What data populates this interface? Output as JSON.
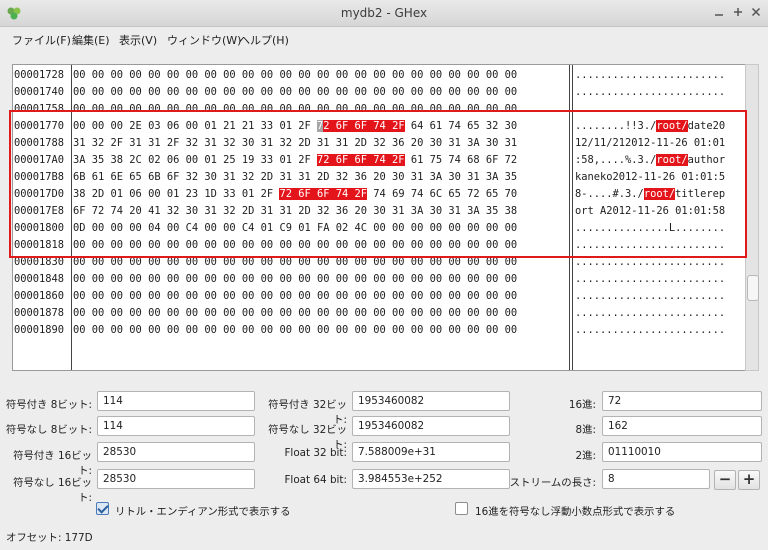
{
  "window": {
    "title": "mydb2 - GHex"
  },
  "menu": [
    "ファイル(F)",
    "編集(E)",
    "表示(V)",
    "ウィンドウ(W)",
    "ヘルプ(H)"
  ],
  "hex": {
    "offsets": [
      "00001728",
      "00001740",
      "00001758",
      "00001770",
      "00001788",
      "000017A0",
      "000017B8",
      "000017D0",
      "000017E8",
      "00001800",
      "00001818",
      "00001830",
      "00001848",
      "00001860",
      "00001878",
      "00001890"
    ],
    "hex_rows": [
      [
        {
          "t": "00 00 00 00 00 00 00 00 00 00 00 00 00 00 00 00 00 00 00 00 00 00 00 00"
        }
      ],
      [
        {
          "t": "00 00 00 00 00 00 00 00 00 00 00 00 00 00 00 00 00 00 00 00 00 00 00 00"
        }
      ],
      [
        {
          "t": "00 00 00 00 00 00 00 00 00 00 00 00 00 00 00 00 00 00 00 00 00 00 00 00"
        }
      ],
      [
        {
          "t": "00 00 00 2E 03 06 00 01 21 21 33 01 2F "
        },
        {
          "t": "7",
          "c": "cur"
        },
        {
          "t": "2 6F 6F 74 2F",
          "c": "hl"
        },
        {
          "t": " 64 61 74 65 32 30"
        }
      ],
      [
        {
          "t": "31 32 2F 31 31 2F 32 31 32 30 31 32 2D 31 31 2D 32 36 20 30 31 3A 30 31"
        }
      ],
      [
        {
          "t": "3A 35 38 2C 02 06 00 01 25 19 33 01 2F "
        },
        {
          "t": "72 6F 6F 74 2F",
          "c": "hl"
        },
        {
          "t": " 61 75 74 68 6F 72"
        }
      ],
      [
        {
          "t": "6B 61 6E 65 6B 6F 32 30 31 32 2D 31 31 2D 32 36 20 30 31 3A 30 31 3A 35"
        }
      ],
      [
        {
          "t": "38 2D 01 06 00 01 23 1D 33 01 2F "
        },
        {
          "t": "72 6F 6F 74 2F",
          "c": "hl"
        },
        {
          "t": " 74 69 74 6C 65 72 65 70"
        }
      ],
      [
        {
          "t": "6F 72 74 20 41 32 30 31 32 2D 31 31 2D 32 36 20 30 31 3A 30 31 3A 35 38"
        }
      ],
      [
        {
          "t": "0D 00 00 00 04 00 C4 00 00 C4 01 C9 01 FA 02 4C 00 00 00 00 00 00 00 00"
        }
      ],
      [
        {
          "t": "00 00 00 00 00 00 00 00 00 00 00 00 00 00 00 00 00 00 00 00 00 00 00 00"
        }
      ],
      [
        {
          "t": "00 00 00 00 00 00 00 00 00 00 00 00 00 00 00 00 00 00 00 00 00 00 00 00"
        }
      ],
      [
        {
          "t": "00 00 00 00 00 00 00 00 00 00 00 00 00 00 00 00 00 00 00 00 00 00 00 00"
        }
      ],
      [
        {
          "t": "00 00 00 00 00 00 00 00 00 00 00 00 00 00 00 00 00 00 00 00 00 00 00 00"
        }
      ],
      [
        {
          "t": "00 00 00 00 00 00 00 00 00 00 00 00 00 00 00 00 00 00 00 00 00 00 00 00"
        }
      ],
      [
        {
          "t": "00 00 00 00 00 00 00 00 00 00 00 00 00 00 00 00 00 00 00 00 00 00 00 00"
        }
      ]
    ],
    "ascii_rows": [
      [
        {
          "t": "........................"
        }
      ],
      [
        {
          "t": "........................"
        }
      ],
      [
        {
          "t": "........................"
        }
      ],
      [
        {
          "t": "........!!3./"
        },
        {
          "t": "root/",
          "c": "hl"
        },
        {
          "t": "date20"
        }
      ],
      [
        {
          "t": "12/11/212012-11-26 01:01"
        }
      ],
      [
        {
          "t": ":58,....%.3./"
        },
        {
          "t": "root/",
          "c": "hl"
        },
        {
          "t": "author"
        }
      ],
      [
        {
          "t": "kaneko2012-11-26 01:01:5"
        }
      ],
      [
        {
          "t": "8-....#.3./"
        },
        {
          "t": "root/",
          "c": "hl"
        },
        {
          "t": "titlerep"
        }
      ],
      [
        {
          "t": "ort A2012-11-26 01:01:58"
        }
      ],
      [
        {
          "t": "...............L........"
        }
      ],
      [
        {
          "t": "........................"
        }
      ],
      [
        {
          "t": "........................"
        }
      ],
      [
        {
          "t": "........................"
        }
      ],
      [
        {
          "t": "........................"
        }
      ],
      [
        {
          "t": "........................"
        }
      ],
      [
        {
          "t": "........................"
        }
      ]
    ]
  },
  "fields": {
    "signed8": {
      "label": "符号付き 8ビット:",
      "value": "114"
    },
    "unsigned8": {
      "label": "符号なし 8ビット:",
      "value": "114"
    },
    "signed16": {
      "label": "符号付き 16ビット:",
      "value": "28530"
    },
    "unsigned16": {
      "label": "符号なし 16ビット:",
      "value": "28530"
    },
    "signed32": {
      "label": "符号付き 32ビット:",
      "value": "1953460082"
    },
    "unsigned32": {
      "label": "符号なし 32ビット:",
      "value": "1953460082"
    },
    "float32": {
      "label": "Float 32 bit:",
      "value": "7.588009e+31"
    },
    "float64": {
      "label": "Float 64 bit:",
      "value": "3.984553e+252"
    },
    "hex": {
      "label": "16進:",
      "value": "72"
    },
    "oct": {
      "label": "8進:",
      "value": "162"
    },
    "bin": {
      "label": "2進:",
      "value": "01110010"
    },
    "stream": {
      "label": "ストリームの長さ:",
      "value": "8"
    }
  },
  "stepper": {
    "minus": "−",
    "plus": "+"
  },
  "checks": {
    "little_endian": {
      "label": "リトル・エンディアン形式で表示する",
      "checked": true
    },
    "unsigned_float_hex": {
      "label": "16進を符号なし浮動小数点形式で表示する",
      "checked": false
    }
  },
  "status": {
    "offset": "オフセット: 177D"
  },
  "colors": {
    "highlight": "#e4141b",
    "annotation_box": "#e01a1a"
  }
}
